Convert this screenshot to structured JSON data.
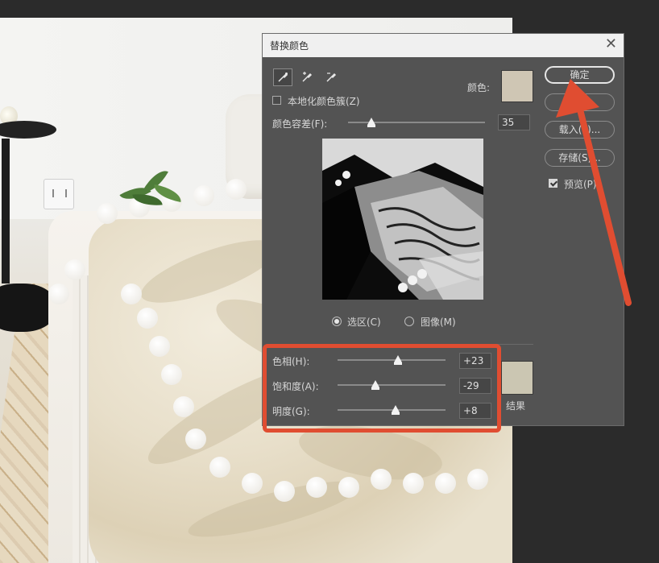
{
  "dialog": {
    "title": "替换颜色",
    "close_glyph": "✕",
    "color_label": "颜色:",
    "color_swatch": "#cfc6b4",
    "localized_label": "本地化颜色簇(Z)",
    "localized_checked": false,
    "tolerance_label": "颜色容差(F):",
    "tolerance_value": "35",
    "tolerance_fraction": 0.17,
    "radio_selection": "选区(C)",
    "radio_image": "图像(M)",
    "radio_selected": "selection",
    "hue_label": "色相(H):",
    "hue_value": "+23",
    "hue_fraction": 0.56,
    "saturation_label": "饱和度(A):",
    "saturation_value": "-29",
    "saturation_fraction": 0.35,
    "lightness_label": "明度(G):",
    "lightness_value": "+8",
    "lightness_fraction": 0.54,
    "result_label": "结果",
    "result_swatch": "#cbc6b2"
  },
  "buttons": {
    "ok": "确定",
    "cancel": "取消",
    "load": "载入(L)...",
    "save": "存储(S)...",
    "preview_label": "预览(P)",
    "preview_checked": true
  },
  "annotation": {
    "highlight_color": "#e04d31"
  },
  "icons": [
    "eyedropper-icon",
    "eyedropper-plus-icon",
    "eyedropper-minus-icon",
    "close-icon",
    "arrow-annotation"
  ]
}
